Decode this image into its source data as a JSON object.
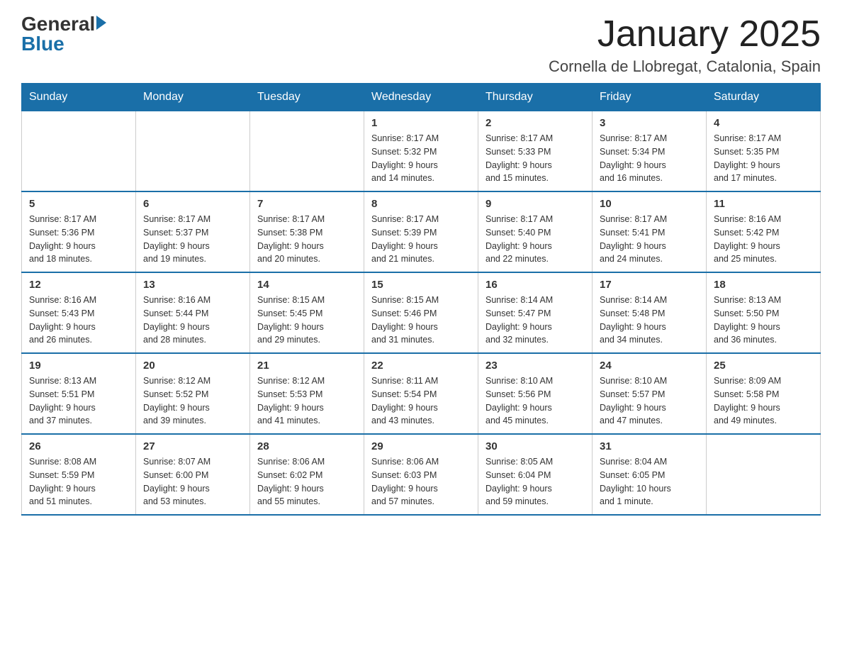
{
  "header": {
    "logo_general": "General",
    "logo_blue": "Blue",
    "month_title": "January 2025",
    "location": "Cornella de Llobregat, Catalonia, Spain"
  },
  "days_of_week": [
    "Sunday",
    "Monday",
    "Tuesday",
    "Wednesday",
    "Thursday",
    "Friday",
    "Saturday"
  ],
  "weeks": [
    [
      {
        "day": "",
        "info": ""
      },
      {
        "day": "",
        "info": ""
      },
      {
        "day": "",
        "info": ""
      },
      {
        "day": "1",
        "info": "Sunrise: 8:17 AM\nSunset: 5:32 PM\nDaylight: 9 hours\nand 14 minutes."
      },
      {
        "day": "2",
        "info": "Sunrise: 8:17 AM\nSunset: 5:33 PM\nDaylight: 9 hours\nand 15 minutes."
      },
      {
        "day": "3",
        "info": "Sunrise: 8:17 AM\nSunset: 5:34 PM\nDaylight: 9 hours\nand 16 minutes."
      },
      {
        "day": "4",
        "info": "Sunrise: 8:17 AM\nSunset: 5:35 PM\nDaylight: 9 hours\nand 17 minutes."
      }
    ],
    [
      {
        "day": "5",
        "info": "Sunrise: 8:17 AM\nSunset: 5:36 PM\nDaylight: 9 hours\nand 18 minutes."
      },
      {
        "day": "6",
        "info": "Sunrise: 8:17 AM\nSunset: 5:37 PM\nDaylight: 9 hours\nand 19 minutes."
      },
      {
        "day": "7",
        "info": "Sunrise: 8:17 AM\nSunset: 5:38 PM\nDaylight: 9 hours\nand 20 minutes."
      },
      {
        "day": "8",
        "info": "Sunrise: 8:17 AM\nSunset: 5:39 PM\nDaylight: 9 hours\nand 21 minutes."
      },
      {
        "day": "9",
        "info": "Sunrise: 8:17 AM\nSunset: 5:40 PM\nDaylight: 9 hours\nand 22 minutes."
      },
      {
        "day": "10",
        "info": "Sunrise: 8:17 AM\nSunset: 5:41 PM\nDaylight: 9 hours\nand 24 minutes."
      },
      {
        "day": "11",
        "info": "Sunrise: 8:16 AM\nSunset: 5:42 PM\nDaylight: 9 hours\nand 25 minutes."
      }
    ],
    [
      {
        "day": "12",
        "info": "Sunrise: 8:16 AM\nSunset: 5:43 PM\nDaylight: 9 hours\nand 26 minutes."
      },
      {
        "day": "13",
        "info": "Sunrise: 8:16 AM\nSunset: 5:44 PM\nDaylight: 9 hours\nand 28 minutes."
      },
      {
        "day": "14",
        "info": "Sunrise: 8:15 AM\nSunset: 5:45 PM\nDaylight: 9 hours\nand 29 minutes."
      },
      {
        "day": "15",
        "info": "Sunrise: 8:15 AM\nSunset: 5:46 PM\nDaylight: 9 hours\nand 31 minutes."
      },
      {
        "day": "16",
        "info": "Sunrise: 8:14 AM\nSunset: 5:47 PM\nDaylight: 9 hours\nand 32 minutes."
      },
      {
        "day": "17",
        "info": "Sunrise: 8:14 AM\nSunset: 5:48 PM\nDaylight: 9 hours\nand 34 minutes."
      },
      {
        "day": "18",
        "info": "Sunrise: 8:13 AM\nSunset: 5:50 PM\nDaylight: 9 hours\nand 36 minutes."
      }
    ],
    [
      {
        "day": "19",
        "info": "Sunrise: 8:13 AM\nSunset: 5:51 PM\nDaylight: 9 hours\nand 37 minutes."
      },
      {
        "day": "20",
        "info": "Sunrise: 8:12 AM\nSunset: 5:52 PM\nDaylight: 9 hours\nand 39 minutes."
      },
      {
        "day": "21",
        "info": "Sunrise: 8:12 AM\nSunset: 5:53 PM\nDaylight: 9 hours\nand 41 minutes."
      },
      {
        "day": "22",
        "info": "Sunrise: 8:11 AM\nSunset: 5:54 PM\nDaylight: 9 hours\nand 43 minutes."
      },
      {
        "day": "23",
        "info": "Sunrise: 8:10 AM\nSunset: 5:56 PM\nDaylight: 9 hours\nand 45 minutes."
      },
      {
        "day": "24",
        "info": "Sunrise: 8:10 AM\nSunset: 5:57 PM\nDaylight: 9 hours\nand 47 minutes."
      },
      {
        "day": "25",
        "info": "Sunrise: 8:09 AM\nSunset: 5:58 PM\nDaylight: 9 hours\nand 49 minutes."
      }
    ],
    [
      {
        "day": "26",
        "info": "Sunrise: 8:08 AM\nSunset: 5:59 PM\nDaylight: 9 hours\nand 51 minutes."
      },
      {
        "day": "27",
        "info": "Sunrise: 8:07 AM\nSunset: 6:00 PM\nDaylight: 9 hours\nand 53 minutes."
      },
      {
        "day": "28",
        "info": "Sunrise: 8:06 AM\nSunset: 6:02 PM\nDaylight: 9 hours\nand 55 minutes."
      },
      {
        "day": "29",
        "info": "Sunrise: 8:06 AM\nSunset: 6:03 PM\nDaylight: 9 hours\nand 57 minutes."
      },
      {
        "day": "30",
        "info": "Sunrise: 8:05 AM\nSunset: 6:04 PM\nDaylight: 9 hours\nand 59 minutes."
      },
      {
        "day": "31",
        "info": "Sunrise: 8:04 AM\nSunset: 6:05 PM\nDaylight: 10 hours\nand 1 minute."
      },
      {
        "day": "",
        "info": ""
      }
    ]
  ]
}
